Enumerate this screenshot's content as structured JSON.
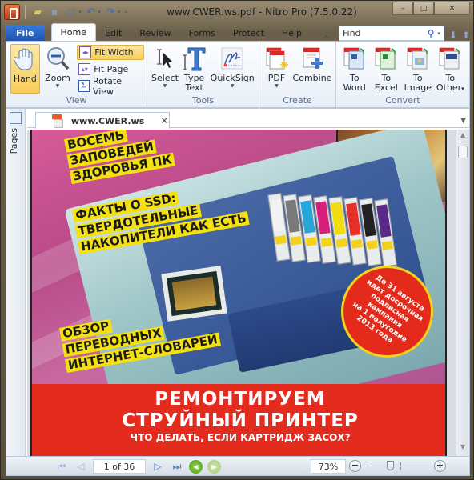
{
  "window": {
    "title": "www.CWER.ws.pdf - Nitro Pro (7.5.0.22)",
    "controls": {
      "minimize": "–",
      "maximize": "□",
      "close": "✕"
    }
  },
  "quick_access": [
    {
      "name": "open-icon",
      "glyph": "📂"
    },
    {
      "name": "save-icon",
      "glyph": "💾"
    },
    {
      "name": "print-icon",
      "glyph": "🖶"
    },
    {
      "name": "undo-icon",
      "glyph": "↶"
    },
    {
      "name": "redo-icon",
      "glyph": "↷"
    }
  ],
  "ribbon_tabs": [
    "File",
    "Home",
    "Edit",
    "Review",
    "Forms",
    "Protect",
    "Help"
  ],
  "active_tab": "Home",
  "find": {
    "placeholder": "Find"
  },
  "groups": {
    "view": {
      "label": "View",
      "hand": "Hand",
      "zoom": "Zoom",
      "fit_width": "Fit Width",
      "fit_page": "Fit Page",
      "rotate_view": "Rotate View"
    },
    "tools": {
      "label": "Tools",
      "select": "Select",
      "type_text_1": "Type",
      "type_text_2": "Text",
      "quicksign": "QuickSign"
    },
    "create": {
      "label": "Create",
      "pdf": "PDF",
      "combine": "Combine"
    },
    "convert": {
      "label": "Convert",
      "to_word": [
        "To",
        "Word"
      ],
      "to_excel": [
        "To",
        "Excel"
      ],
      "to_image": [
        "To",
        "Image"
      ],
      "to_other": [
        "To",
        "Other"
      ]
    }
  },
  "side_panel": {
    "pages_label": "Pages"
  },
  "document_tab": {
    "name": "www.CWER.ws",
    "close": "✕"
  },
  "cover": {
    "headline1": [
      "ВОСЕМЬ",
      "ЗАПОВЕДЕЙ",
      "ЗДОРОВЬЯ ПК"
    ],
    "headline2": [
      "ФАКТЫ О SSD:",
      "ТВЕРДОТЕЛЬНЫЕ",
      "НАКОПИТЕЛИ КАК ЕСТЬ"
    ],
    "headline3": [
      "ОБЗОР",
      "ПЕРЕВОДНЫХ",
      "ИНТЕРНЕТ-СЛОВАРЕЙ"
    ],
    "badge": [
      "До 31 августа",
      "идет досрочная",
      "подписная",
      "кампания",
      "на 1 полугодие",
      "2013 года"
    ],
    "banner_line1": "РЕМОНТИРУЕМ",
    "banner_line2": "СТРУЙНЫЙ ПРИНТЕР",
    "banner_line3": "ЧТО ДЕЛАТЬ, ЕСЛИ КАРТРИДЖ ЗАСОХ?",
    "cartridge_colors": [
      "#f2f2f2",
      "#7a7a7a",
      "#27a6d8",
      "#d81f7a",
      "#f2dc10",
      "#e5302a",
      "#222222",
      "#5a2a8a"
    ]
  },
  "status_bar": {
    "page_indicator": "1 of 36",
    "zoom_level": "73%",
    "zoom_slider_fraction": 0.38
  }
}
